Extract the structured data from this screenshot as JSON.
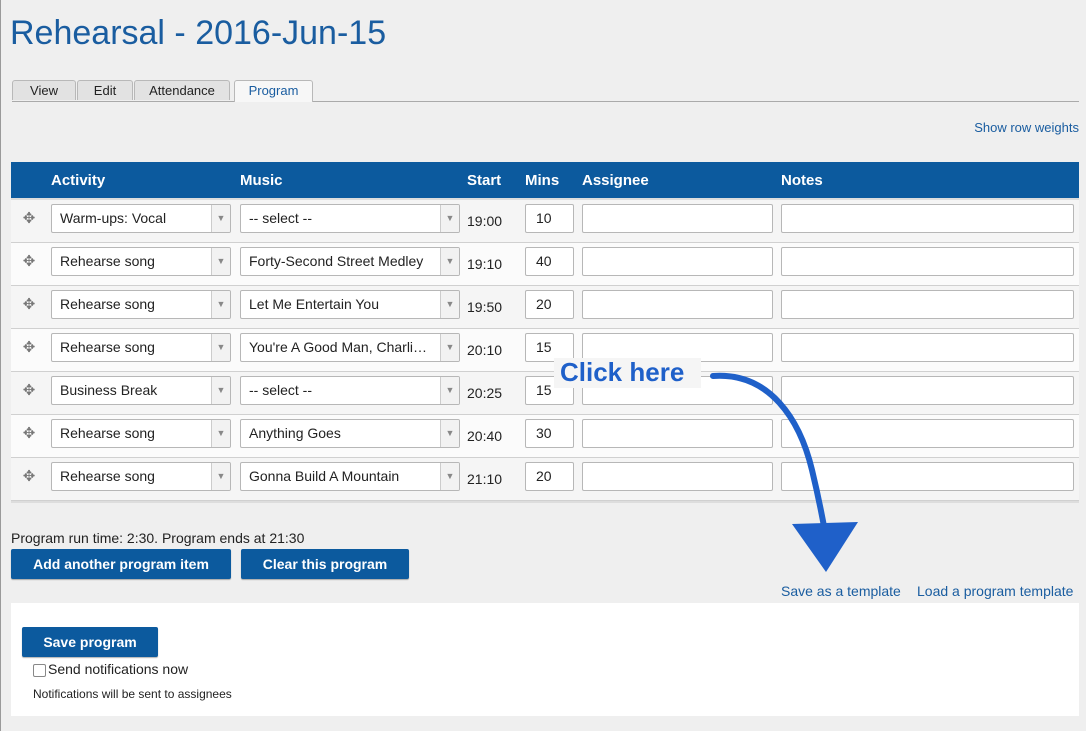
{
  "page": {
    "title": "Rehearsal - 2016-Jun-15"
  },
  "tabs": [
    {
      "label": "View"
    },
    {
      "label": "Edit"
    },
    {
      "label": "Attendance"
    },
    {
      "label": "Program",
      "active": true
    }
  ],
  "links": {
    "show_row_weights": "Show row weights",
    "save_template": "Save as a template",
    "load_template": "Load a program template"
  },
  "table": {
    "headers": [
      "Activity",
      "Music",
      "Start",
      "Mins",
      "Assignee",
      "Notes"
    ],
    "rows": [
      {
        "activity": "Warm-ups: Vocal",
        "music": "-- select --",
        "start": "19:00",
        "mins": "10",
        "assignee": "",
        "notes": ""
      },
      {
        "activity": "Rehearse song",
        "music": "Forty-Second Street Medley",
        "start": "19:10",
        "mins": "40",
        "assignee": "",
        "notes": ""
      },
      {
        "activity": "Rehearse song",
        "music": "Let Me Entertain You",
        "start": "19:50",
        "mins": "20",
        "assignee": "",
        "notes": ""
      },
      {
        "activity": "Rehearse song",
        "music": "You're A Good Man, Charli…",
        "start": "20:10",
        "mins": "15",
        "assignee": "",
        "notes": ""
      },
      {
        "activity": "Business Break",
        "music": "-- select --",
        "start": "20:25",
        "mins": "15",
        "assignee": "",
        "notes": ""
      },
      {
        "activity": "Rehearse song",
        "music": "Anything Goes",
        "start": "20:40",
        "mins": "30",
        "assignee": "",
        "notes": ""
      },
      {
        "activity": "Rehearse song",
        "music": "Gonna Build A Mountain",
        "start": "21:10",
        "mins": "20",
        "assignee": "",
        "notes": ""
      }
    ]
  },
  "program": {
    "runtime": "Program run time: 2:30. Program ends at 21:30",
    "add_item": "Add another program item",
    "clear": "Clear this program",
    "save": "Save program",
    "send_notifications": "Send notifications now",
    "notifications_note": "Notifications will be sent to assignees"
  },
  "annotation": {
    "text": "Click here",
    "color": "#1f60c9"
  },
  "colors": {
    "header_bg": "#0c5a9e",
    "link": "#1a5da0",
    "button_bg": "#0c5a9e"
  },
  "icons": {
    "drag_handle": "drag-handle-icon",
    "dropdown": "chevron-down-icon"
  }
}
